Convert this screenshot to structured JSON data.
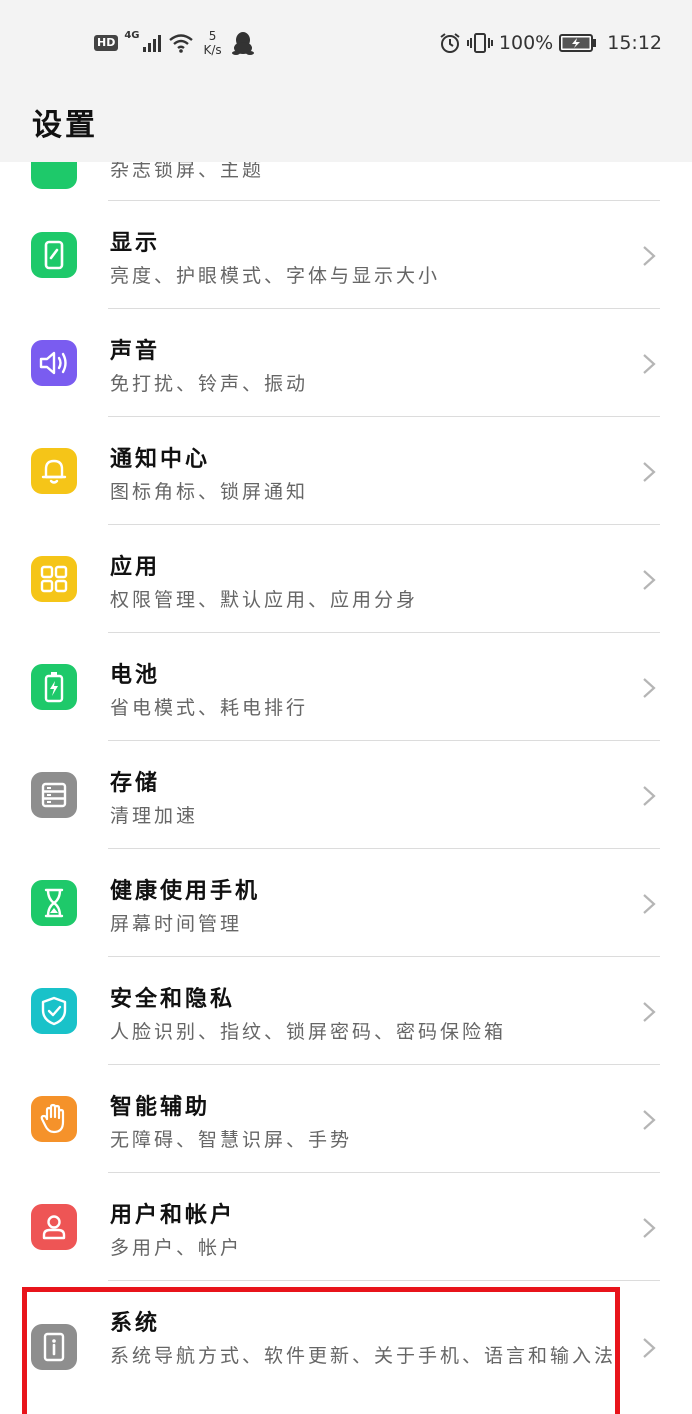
{
  "status_bar": {
    "hd": "HD",
    "network": "4G",
    "speed_value": "5",
    "speed_unit": "K/s",
    "battery": "100%",
    "time": "15:12"
  },
  "header": {
    "title": "设置"
  },
  "settings": [
    {
      "id": "partial",
      "title": "",
      "subtitle": "杂志锁屏、主题",
      "icon": "partial-green-icon",
      "color": "#1db954"
    },
    {
      "id": "display",
      "title": "显示",
      "subtitle": "亮度、护眼模式、字体与显示大小",
      "icon": "display-icon",
      "color": "#1ec96a"
    },
    {
      "id": "sound",
      "title": "声音",
      "subtitle": "免打扰、铃声、振动",
      "icon": "speaker-icon",
      "color": "#7a5cf0"
    },
    {
      "id": "notification",
      "title": "通知中心",
      "subtitle": "图标角标、锁屏通知",
      "icon": "bell-icon",
      "color": "#f5c518"
    },
    {
      "id": "apps",
      "title": "应用",
      "subtitle": "权限管理、默认应用、应用分身",
      "icon": "apps-grid-icon",
      "color": "#f5c518"
    },
    {
      "id": "battery",
      "title": "电池",
      "subtitle": "省电模式、耗电排行",
      "icon": "battery-icon",
      "color": "#1ec96a"
    },
    {
      "id": "storage",
      "title": "存储",
      "subtitle": "清理加速",
      "icon": "storage-icon",
      "color": "#8e8e8e"
    },
    {
      "id": "digital-balance",
      "title": "健康使用手机",
      "subtitle": "屏幕时间管理",
      "icon": "hourglass-icon",
      "color": "#1ec96a"
    },
    {
      "id": "security",
      "title": "安全和隐私",
      "subtitle": "人脸识别、指纹、锁屏密码、密码保险箱",
      "icon": "shield-icon",
      "color": "#19c2c9"
    },
    {
      "id": "accessibility",
      "title": "智能辅助",
      "subtitle": "无障碍、智慧识屏、手势",
      "icon": "hand-icon",
      "color": "#f5922a"
    },
    {
      "id": "users",
      "title": "用户和帐户",
      "subtitle": "多用户、帐户",
      "icon": "user-icon",
      "color": "#ee5555"
    },
    {
      "id": "system",
      "title": "系统",
      "subtitle": "系统导航方式、软件更新、关于手机、语言和输入法",
      "icon": "info-icon",
      "color": "#8e8e8e"
    }
  ],
  "colors": {
    "highlight": "#e8141b",
    "header_bg": "#f3f3f3"
  }
}
